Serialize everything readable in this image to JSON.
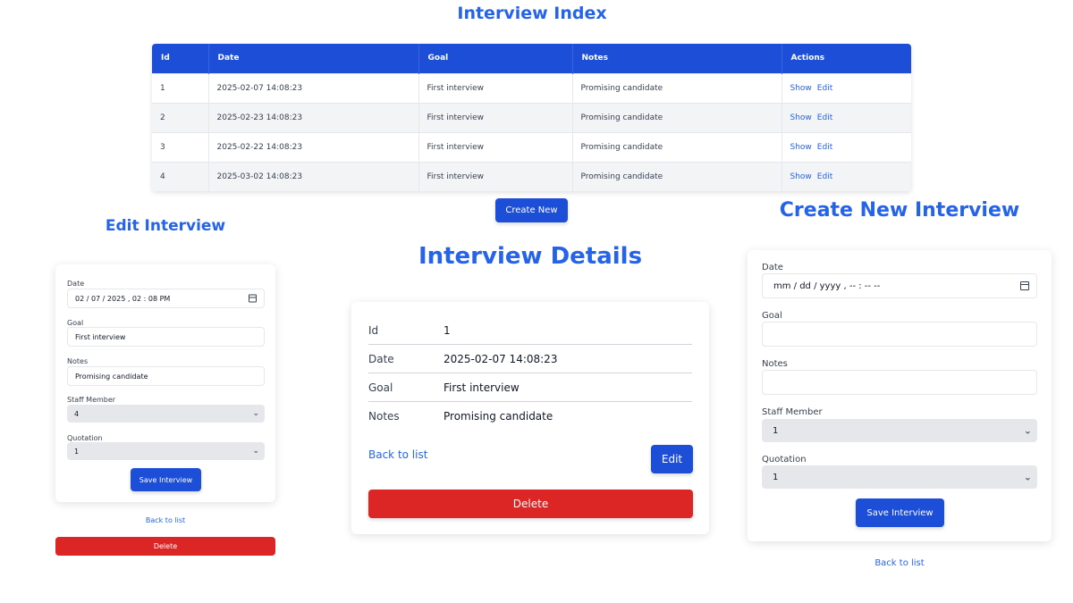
{
  "index": {
    "title": "Interview Index",
    "columns": [
      "Id",
      "Date",
      "Goal",
      "Notes",
      "Actions"
    ],
    "rows": [
      {
        "id": "1",
        "date": "2025-02-07 14:08:23",
        "goal": "First interview",
        "notes": "Promising candidate"
      },
      {
        "id": "2",
        "date": "2025-02-23 14:08:23",
        "goal": "First interview",
        "notes": "Promising candidate"
      },
      {
        "id": "3",
        "date": "2025-02-22 14:08:23",
        "goal": "First interview",
        "notes": "Promising candidate"
      },
      {
        "id": "4",
        "date": "2025-03-02 14:08:23",
        "goal": "First interview",
        "notes": "Promising candidate"
      }
    ],
    "show_label": "Show",
    "edit_label": "Edit",
    "create_new_label": "Create New"
  },
  "edit": {
    "title": "Edit Interview",
    "date_label": "Date",
    "date_value": "02 / 07 / 2025 ,  02 : 08  PM",
    "goal_label": "Goal",
    "goal_value": "First interview",
    "notes_label": "Notes",
    "notes_value": "Promising candidate",
    "staff_label": "Staff Member",
    "staff_value": "4",
    "quotation_label": "Quotation",
    "quotation_value": "1",
    "save_label": "Save Interview",
    "back_label": "Back to list",
    "delete_label": "Delete"
  },
  "details": {
    "title": "Interview Details",
    "fields": [
      {
        "key": "Id",
        "value": "1"
      },
      {
        "key": "Date",
        "value": "2025-02-07 14:08:23"
      },
      {
        "key": "Goal",
        "value": "First interview"
      },
      {
        "key": "Notes",
        "value": "Promising candidate"
      }
    ],
    "back_label": "Back to list",
    "edit_label": "Edit",
    "delete_label": "Delete"
  },
  "create": {
    "title": "Create New Interview",
    "date_label": "Date",
    "date_placeholder": "mm / dd / yyyy ,  -- : --   --",
    "goal_label": "Goal",
    "notes_label": "Notes",
    "staff_label": "Staff Member",
    "staff_value": "1",
    "quotation_label": "Quotation",
    "quotation_value": "1",
    "save_label": "Save Interview",
    "back_label": "Back to list"
  },
  "colors": {
    "primary": "#1d4ed8",
    "title_blue": "#2563eb",
    "danger": "#dc2626"
  }
}
